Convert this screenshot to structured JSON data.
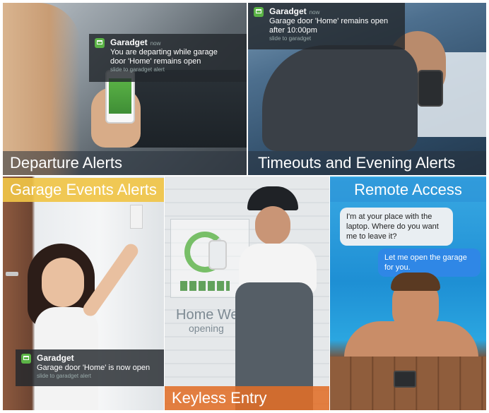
{
  "tiles": {
    "departure": {
      "caption": "Departure Alerts",
      "notification": {
        "app": "Garadget",
        "time": "now",
        "line1": "You are departing while garage",
        "line2": "door 'Home' remains open",
        "slide": "slide to garadget alert"
      }
    },
    "timeouts": {
      "caption": "Timeouts and Evening Alerts",
      "notification": {
        "app": "Garadget",
        "time": "now",
        "line1": "Garage door 'Home' remains open",
        "line2": "after 10:00pm",
        "slide": "slide to garadget"
      }
    },
    "events": {
      "caption": "Garage Events Alerts",
      "notification": {
        "app": "Garadget",
        "line1": "Garage door 'Home' is now open",
        "slide": "slide to garadget alert"
      }
    },
    "keyless": {
      "caption": "Keyless Entry",
      "sign_title": "Home West",
      "sign_status": "opening"
    },
    "remote": {
      "caption": "Remote Access",
      "bubble_incoming": "I'm at your place with the laptop. Where do you want me to leave it?",
      "bubble_outgoing": "Let me open the garage for you."
    }
  },
  "colors": {
    "garadget_green": "#5bb346",
    "caption_yellow": "#f0c446",
    "caption_orange": "#e16e28",
    "message_blue": "#2f87e6"
  },
  "icons": [
    "garadget-app-icon"
  ]
}
